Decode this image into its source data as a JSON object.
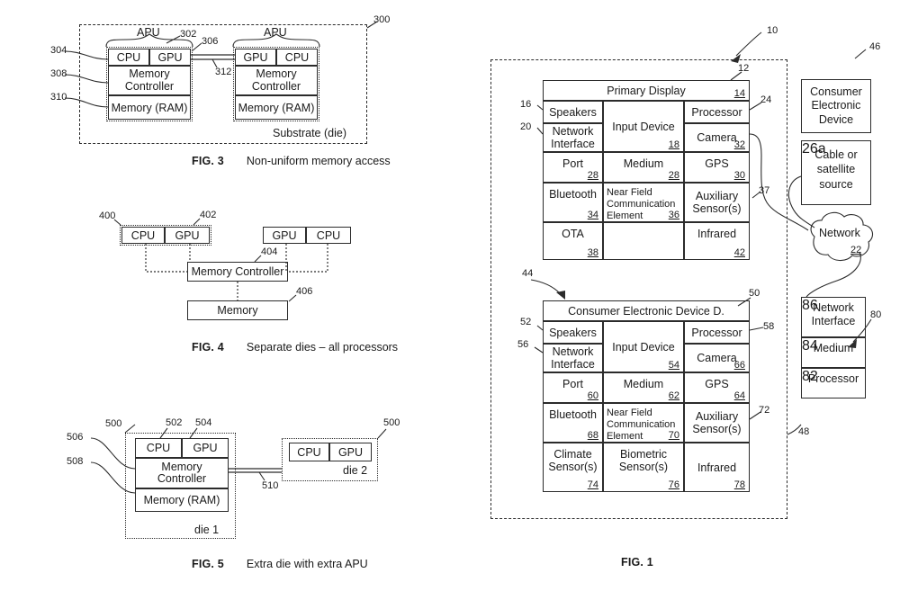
{
  "figures": {
    "fig3": {
      "caption_label": "FIG. 3",
      "caption_text": "Non-uniform memory access",
      "outer_ref": "300",
      "substrate_label": "Substrate (die)",
      "left_refs": [
        "304",
        "308",
        "310"
      ],
      "top_refs": [
        "302",
        "306"
      ],
      "bus_ref": "312",
      "apu_label": "APU",
      "apu_left": {
        "cpu": "CPU",
        "gpu": "GPU",
        "controller_line1": "Memory",
        "controller_line2": "Controller",
        "memory": "Memory (RAM)"
      },
      "apu_right": {
        "gpu": "GPU",
        "cpu": "CPU",
        "controller_line1": "Memory",
        "controller_line2": "Controller",
        "memory": "Memory (RAM)"
      }
    },
    "fig4": {
      "caption_label": "FIG. 4",
      "caption_text": "Separate dies – all processors",
      "left_cpu": "CPU",
      "left_gpu": "GPU",
      "right_gpu": "GPU",
      "right_cpu": "CPU",
      "controller": "Memory Controller",
      "memory": "Memory",
      "refs": {
        "cpu": "400",
        "gpu": "402",
        "controller": "404",
        "memory": "406"
      }
    },
    "fig5": {
      "caption_label": "FIG. 5",
      "caption_text": "Extra die with extra APU",
      "die1_label": "die 1",
      "die2_label": "die 2",
      "die1": {
        "cpu": "CPU",
        "gpu": "GPU",
        "controller_line1": "Memory",
        "controller_line2": "Controller",
        "memory": "Memory (RAM)"
      },
      "die2": {
        "cpu": "CPU",
        "gpu": "GPU"
      },
      "refs": {
        "die1": "500",
        "cpu": "502",
        "gpu": "504",
        "controller": "506",
        "memory": "508",
        "link": "510",
        "die2": "500"
      }
    },
    "fig1": {
      "caption_label": "FIG. 1",
      "system_ref": "10",
      "primary": {
        "title": "Primary Display",
        "title_num": "14",
        "title_ref": "12",
        "side_refs": {
          "speakers": "16",
          "network_interface": "20",
          "processor": "24",
          "aux": "37"
        },
        "cells": [
          {
            "text": "Speakers",
            "num": ""
          },
          {
            "text": "Input Device",
            "num": "18"
          },
          {
            "text": "Processor",
            "num": ""
          },
          {
            "text": "Network\nInterface",
            "num": ""
          },
          {
            "text": "Camera",
            "num": "32"
          },
          {
            "text": "Port",
            "num": "28"
          },
          {
            "text": "Medium",
            "num": "28"
          },
          {
            "text": "GPS",
            "num": "30"
          },
          {
            "text": "Bluetooth",
            "num": "34"
          },
          {
            "text": "Near Field\nCommunication\nElement",
            "num": "36"
          },
          {
            "text": "Auxiliary\nSensor(s)",
            "num": ""
          },
          {
            "text": "OTA",
            "num": "38"
          },
          {
            "text": "",
            "num": ""
          },
          {
            "text": "Infrared",
            "num": "42"
          }
        ]
      },
      "secondary": {
        "title": "Consumer Electronic Device D.",
        "title_ref": "50",
        "arrow_ref": "44",
        "side_refs": {
          "speakers": "52",
          "network_interface": "56",
          "processor": "58",
          "aux": "72"
        },
        "cells": [
          {
            "text": "Speakers",
            "num": ""
          },
          {
            "text": "Input Device",
            "num": "54"
          },
          {
            "text": "Processor",
            "num": ""
          },
          {
            "text": "Network\nInterface",
            "num": ""
          },
          {
            "text": "Camera",
            "num": "66"
          },
          {
            "text": "Port",
            "num": "60"
          },
          {
            "text": "Medium",
            "num": "62"
          },
          {
            "text": "GPS",
            "num": "64"
          },
          {
            "text": "Bluetooth",
            "num": "68"
          },
          {
            "text": "Near Field\nCommunication\nElement",
            "num": "70"
          },
          {
            "text": "Auxiliary\nSensor(s)",
            "num": ""
          },
          {
            "text": "Climate\nSensor(s)",
            "num": "74"
          },
          {
            "text": "Biometric\nSensor(s)",
            "num": "76"
          },
          {
            "text": "Infrared",
            "num": "78"
          }
        ]
      },
      "right_column": {
        "consumer_device": {
          "line1": "Consumer",
          "line2": "Electronic",
          "line3": "Device",
          "ref": "46"
        },
        "cable_source": {
          "line1": "Cable or",
          "line2": "satellite",
          "line3": "source",
          "num": "26a"
        },
        "network": {
          "label": "Network",
          "num": "22"
        },
        "server_stack": {
          "ref": "80",
          "bottom_ref": "48",
          "items": [
            {
              "line1": "Network",
              "line2": "Interface",
              "num": "86"
            },
            {
              "line1": "Medium",
              "line2": "",
              "num": "84"
            },
            {
              "line1": "Processor",
              "line2": "",
              "num": "82"
            }
          ]
        }
      }
    }
  }
}
